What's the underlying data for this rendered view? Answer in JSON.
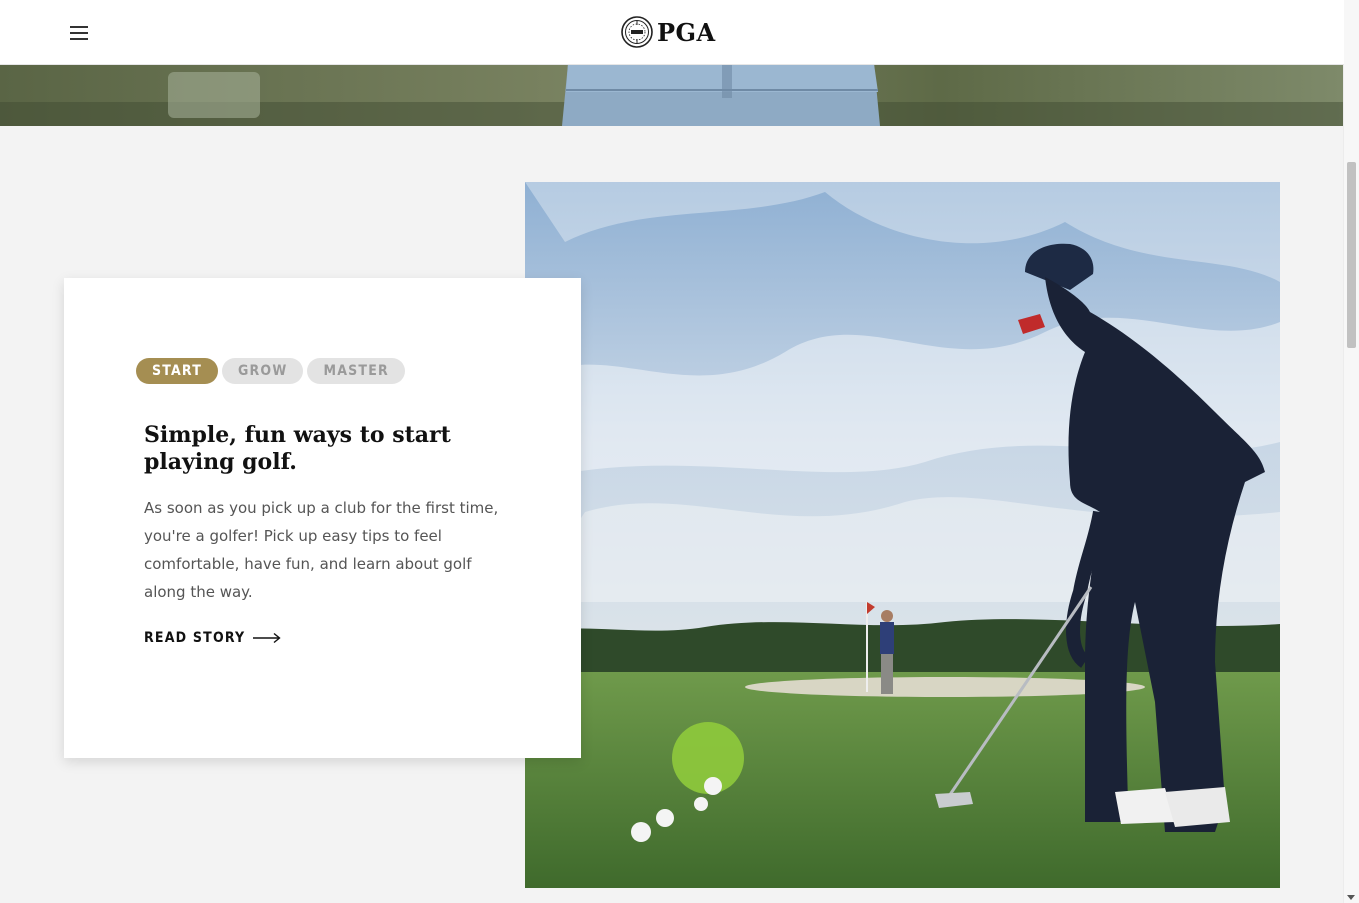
{
  "header": {
    "menu_icon": "hamburger-menu-icon",
    "logo_text": "PGA"
  },
  "feature": {
    "tabs": [
      {
        "label": "START",
        "active": true
      },
      {
        "label": "GROW",
        "active": false
      },
      {
        "label": "MASTER",
        "active": false
      }
    ],
    "headline": "Simple, fun ways to start playing golf.",
    "body": "As soon as you pick up a club for the first time, you're a golfer! Pick up easy tips to feel comfortable, have fun, and learn about golf along the way.",
    "cta_label": "READ STORY",
    "cta_icon": "long-arrow-right-icon"
  },
  "colors": {
    "accent": "#a58e52",
    "inactive_tab_bg": "#e3e3e3",
    "page_bg": "#f3f3f3"
  }
}
